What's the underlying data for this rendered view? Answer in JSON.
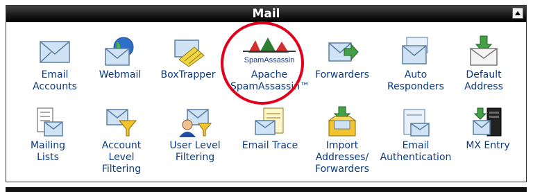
{
  "panel": {
    "title": "Mail"
  },
  "items": [
    {
      "label": "Email\nAccounts",
      "icon": "envelope-icon"
    },
    {
      "label": "Webmail",
      "icon": "webmail-globe-icon"
    },
    {
      "label": "BoxTrapper",
      "icon": "box-trapper-icon"
    },
    {
      "label": "Apache\nSpamAssassin™",
      "icon": "spamassassin-logo",
      "logo_text": "SpamAssassin"
    },
    {
      "label": "Forwarders",
      "icon": "forward-arrow-icon"
    },
    {
      "label": "Auto\nResponders",
      "icon": "autoresponder-icon"
    },
    {
      "label": "Default\nAddress",
      "icon": "default-address-icon"
    },
    {
      "label": "Mailing\nLists",
      "icon": "mailing-list-icon"
    },
    {
      "label": "Account\nLevel\nFiltering",
      "icon": "funnel-icon"
    },
    {
      "label": "User Level\nFiltering",
      "icon": "user-filter-icon"
    },
    {
      "label": "Email Trace",
      "icon": "email-trace-icon"
    },
    {
      "label": "Import\nAddresses/\nForwarders",
      "icon": "import-icon"
    },
    {
      "label": "Email\nAuthentication",
      "icon": "authentication-icon"
    },
    {
      "label": "MX Entry",
      "icon": "mx-server-icon"
    }
  ],
  "colors": {
    "label": "#0b3a7f",
    "highlight": "#e0001b",
    "titlebar": "#1b1b1b"
  }
}
